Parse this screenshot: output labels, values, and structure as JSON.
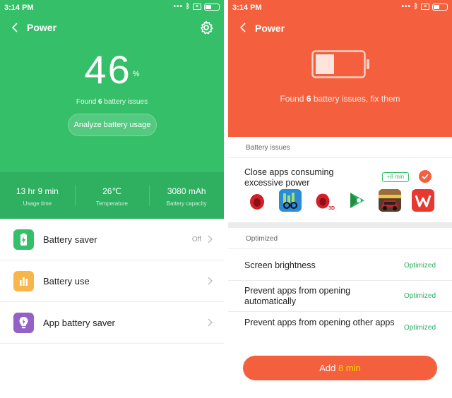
{
  "left": {
    "status": {
      "time": "3:14 PM"
    },
    "title": "Power",
    "battery": {
      "percent": "46",
      "sign": "%"
    },
    "found": {
      "prefix": "Found ",
      "count": "6",
      "suffix": " battery issues"
    },
    "analyze_label": "Analyze battery usage",
    "stats": [
      {
        "value": "13 hr 9 min",
        "label": "Usage time"
      },
      {
        "value": "26℃",
        "label": "Temperature"
      },
      {
        "value": "3080 mAh",
        "label": "Battery capacity"
      }
    ],
    "menu": [
      {
        "label": "Battery saver",
        "value": "Off",
        "icon": "battery-bolt-icon",
        "color": "#34bf68"
      },
      {
        "label": "Battery use",
        "value": "",
        "icon": "bar-chart-icon",
        "color": "#f8b54a"
      },
      {
        "label": "App battery saver",
        "value": "",
        "icon": "lightbulb-icon",
        "color": "#9462c7"
      }
    ],
    "colors": {
      "primary": "#34bf68"
    }
  },
  "right": {
    "status": {
      "time": "3:14 PM"
    },
    "title": "Power",
    "battery_fill": 0.4,
    "found": {
      "prefix": "Found ",
      "count": "6",
      "suffix": " battery issues, fix them"
    },
    "issues_header": "Battery issues",
    "close_apps": {
      "title": "Close apps consuming excessive power",
      "badge": "+8 min",
      "apps": [
        {
          "icon": "antutu-icon"
        },
        {
          "icon": "geekbench-icon"
        },
        {
          "icon": "antutu-3d-icon",
          "caption": "3D"
        },
        {
          "icon": "google-play-games-icon"
        },
        {
          "icon": "racing-game-icon"
        },
        {
          "icon": "wps-office-icon"
        }
      ]
    },
    "optimized_header": "Optimized",
    "optimized": [
      {
        "label": "Screen brightness",
        "status": "Optimized"
      },
      {
        "label": "Prevent apps from opening automatically",
        "status": "Optimized"
      },
      {
        "label": "Prevent apps from opening other apps",
        "status": "Optimized"
      }
    ],
    "add_button": {
      "prefix": "Add ",
      "highlight": "8 min"
    },
    "colors": {
      "primary": "#f4603e",
      "ok": "#2fae5d"
    }
  }
}
